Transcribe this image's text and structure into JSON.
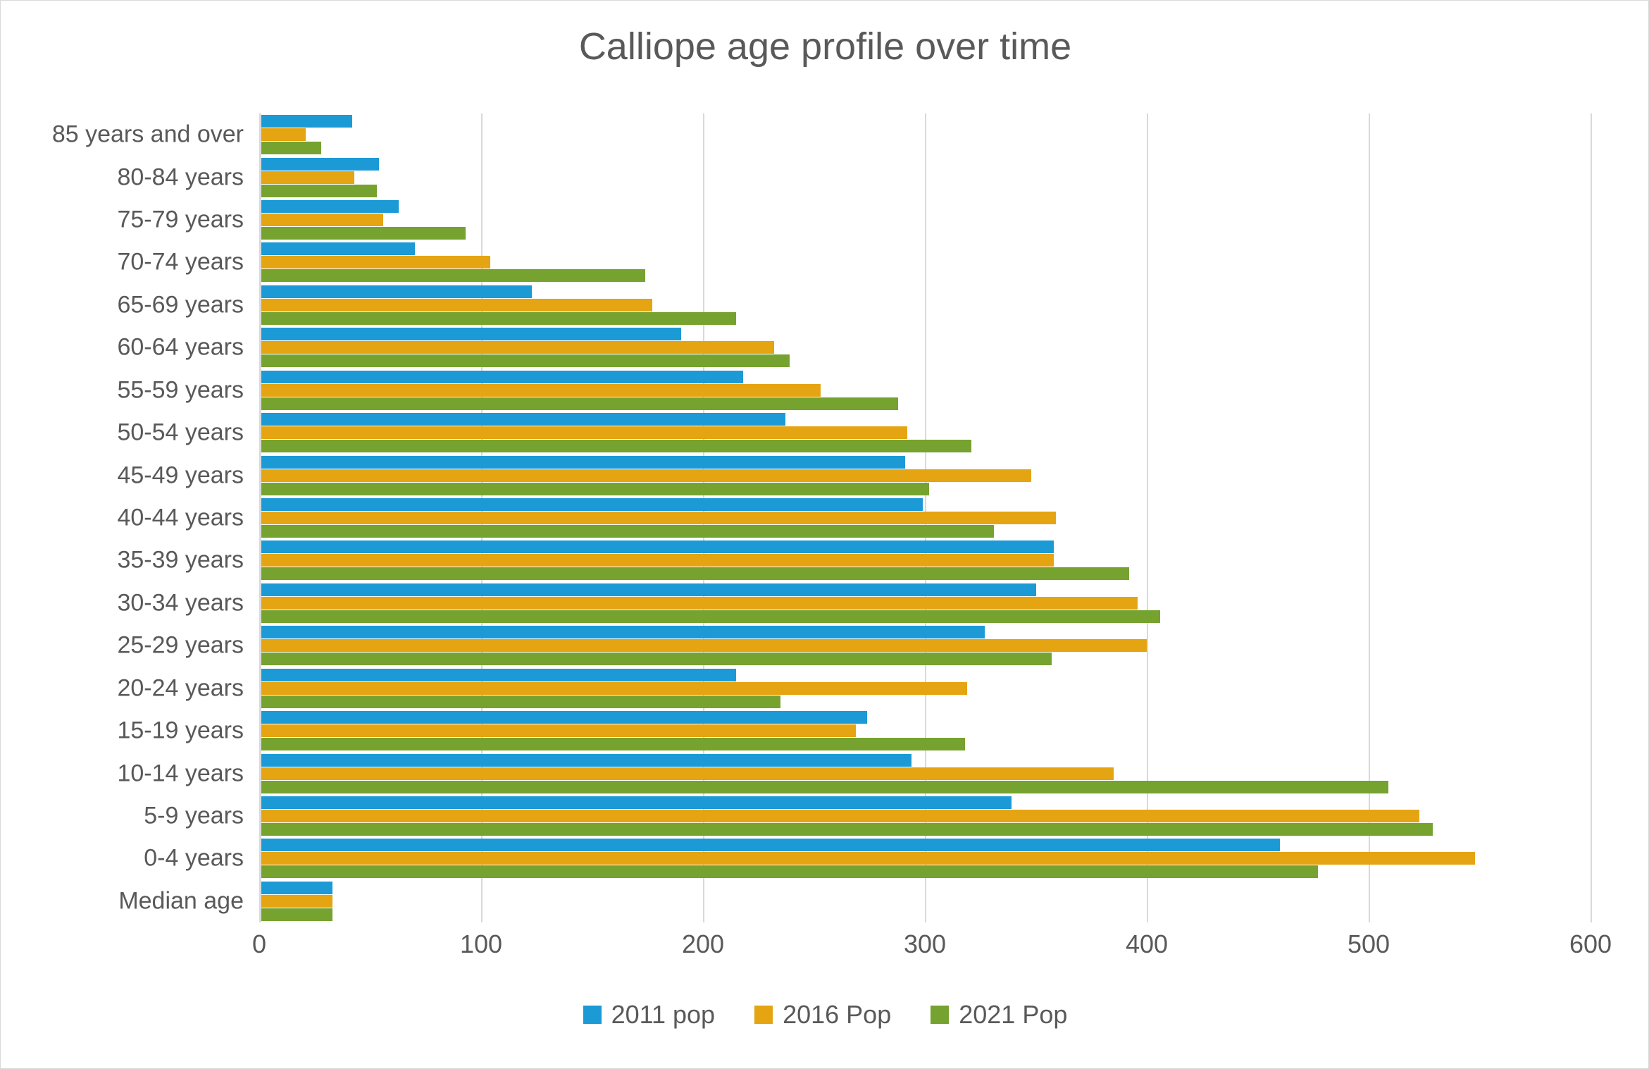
{
  "chart_data": {
    "type": "bar",
    "orientation": "horizontal",
    "title": "Calliope age profile over time",
    "xlabel": "",
    "ylabel": "",
    "xlim": [
      0,
      600
    ],
    "xticks": [
      0,
      100,
      200,
      300,
      400,
      500,
      600
    ],
    "grid": true,
    "legend_position": "bottom",
    "categories": [
      "85 years and over",
      "80-84 years",
      "75-79 years",
      "70-74 years",
      "65-69 years",
      "60-64 years",
      "55-59 years",
      "50-54 years",
      "45-49 years",
      "40-44 years",
      "35-39 years",
      "30-34 years",
      "25-29 years",
      "20-24 years",
      "15-19 years",
      "10-14 years",
      "5-9 years",
      "0-4 years",
      "Median age"
    ],
    "series": [
      {
        "name": "2011 pop",
        "color": "#1B9AD6",
        "values": [
          42,
          54,
          63,
          70,
          123,
          190,
          218,
          237,
          291,
          299,
          358,
          350,
          327,
          215,
          274,
          294,
          339,
          460,
          33
        ]
      },
      {
        "name": "2016 Pop",
        "color": "#E5A412",
        "values": [
          21,
          43,
          56,
          104,
          177,
          232,
          253,
          292,
          348,
          359,
          358,
          396,
          400,
          319,
          269,
          385,
          523,
          548,
          33
        ]
      },
      {
        "name": "2021 Pop",
        "color": "#76A22F",
        "values": [
          28,
          53,
          93,
          174,
          215,
          239,
          288,
          321,
          302,
          331,
          392,
          406,
          357,
          235,
          318,
          509,
          529,
          477,
          33
        ]
      }
    ]
  },
  "colors": {
    "series_2011": "#1B9AD6",
    "series_2016": "#E5A412",
    "series_2021": "#76A22F",
    "gridline": "#D9D9D9",
    "text": "#595959",
    "background": "#FFFFFF",
    "frame_border": "#D9D9D9"
  },
  "legend": {
    "items": [
      {
        "label": "2011 pop",
        "color": "#1B9AD6"
      },
      {
        "label": "2016 Pop",
        "color": "#E5A412"
      },
      {
        "label": "2021 Pop",
        "color": "#76A22F"
      }
    ]
  },
  "axis": {
    "x_tick_labels": [
      "0",
      "100",
      "200",
      "300",
      "400",
      "500",
      "600"
    ]
  }
}
